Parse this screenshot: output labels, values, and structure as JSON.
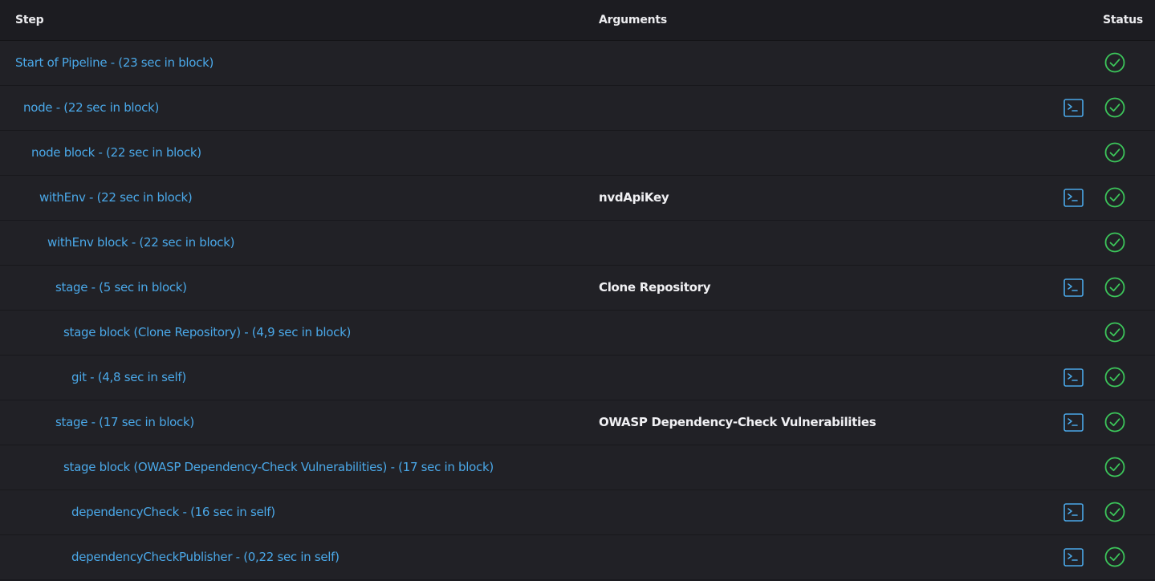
{
  "header": {
    "step_label": "Step",
    "arguments_label": "Arguments",
    "status_label": "Status"
  },
  "colors": {
    "background": "#1d1d22",
    "row_background": "#212126",
    "link": "#4aa8e8",
    "success": "#3cc55a",
    "console_icon": "#4aa8e8"
  },
  "rows": [
    {
      "step": "Start of Pipeline - (23 sec in block)",
      "argument": "",
      "indent": 0,
      "console": false,
      "status": "success-icon"
    },
    {
      "step": "node - (22 sec in block)",
      "argument": "",
      "indent": 1,
      "console": true,
      "status": "success-icon"
    },
    {
      "step": "node block - (22 sec in block)",
      "argument": "",
      "indent": 2,
      "console": false,
      "status": "success-icon"
    },
    {
      "step": "withEnv - (22 sec in block)",
      "argument": "nvdApiKey",
      "indent": 3,
      "console": true,
      "status": "success-icon"
    },
    {
      "step": "withEnv block - (22 sec in block)",
      "argument": "",
      "indent": 4,
      "console": false,
      "status": "success-icon"
    },
    {
      "step": "stage - (5 sec in block)",
      "argument": "Clone Repository",
      "indent": 5,
      "console": true,
      "status": "success-icon"
    },
    {
      "step": "stage block (Clone Repository) - (4,9 sec in block)",
      "argument": "",
      "indent": 6,
      "console": false,
      "status": "success-icon"
    },
    {
      "step": "git - (4,8 sec in self)",
      "argument": "",
      "indent": 7,
      "console": true,
      "status": "success-icon"
    },
    {
      "step": "stage - (17 sec in block)",
      "argument": "OWASP Dependency-Check Vulnerabilities",
      "indent": 5,
      "console": true,
      "status": "success-icon"
    },
    {
      "step": "stage block (OWASP Dependency-Check Vulnerabilities) - (17 sec in block)",
      "argument": "",
      "indent": 6,
      "console": false,
      "status": "success-icon"
    },
    {
      "step": "dependencyCheck - (16 sec in self)",
      "argument": "",
      "indent": 7,
      "console": true,
      "status": "success-icon"
    },
    {
      "step": "dependencyCheckPublisher - (0,22 sec in self)",
      "argument": "",
      "indent": 7,
      "console": true,
      "status": "success-icon"
    }
  ]
}
